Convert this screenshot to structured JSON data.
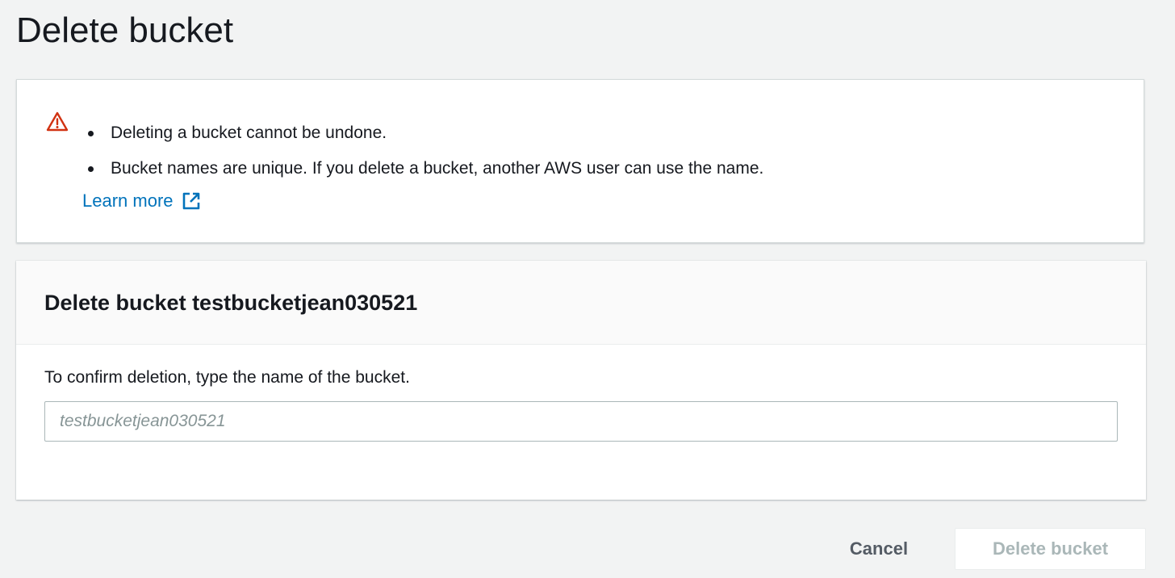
{
  "page": {
    "title": "Delete bucket"
  },
  "warning": {
    "icon": "warning-icon",
    "icon_color": "#d13212",
    "items": [
      "Deleting a bucket cannot be undone.",
      "Bucket names are unique. If you delete a bucket, another AWS user can use the name."
    ],
    "learn_more_label": "Learn more",
    "link_color": "#0073bb"
  },
  "panel": {
    "title": "Delete bucket testbucketjean030521",
    "confirm_label": "To confirm deletion, type the name of the bucket.",
    "input_value": "",
    "input_placeholder": "testbucketjean030521"
  },
  "actions": {
    "cancel_label": "Cancel",
    "delete_label": "Delete bucket",
    "delete_disabled": true
  }
}
